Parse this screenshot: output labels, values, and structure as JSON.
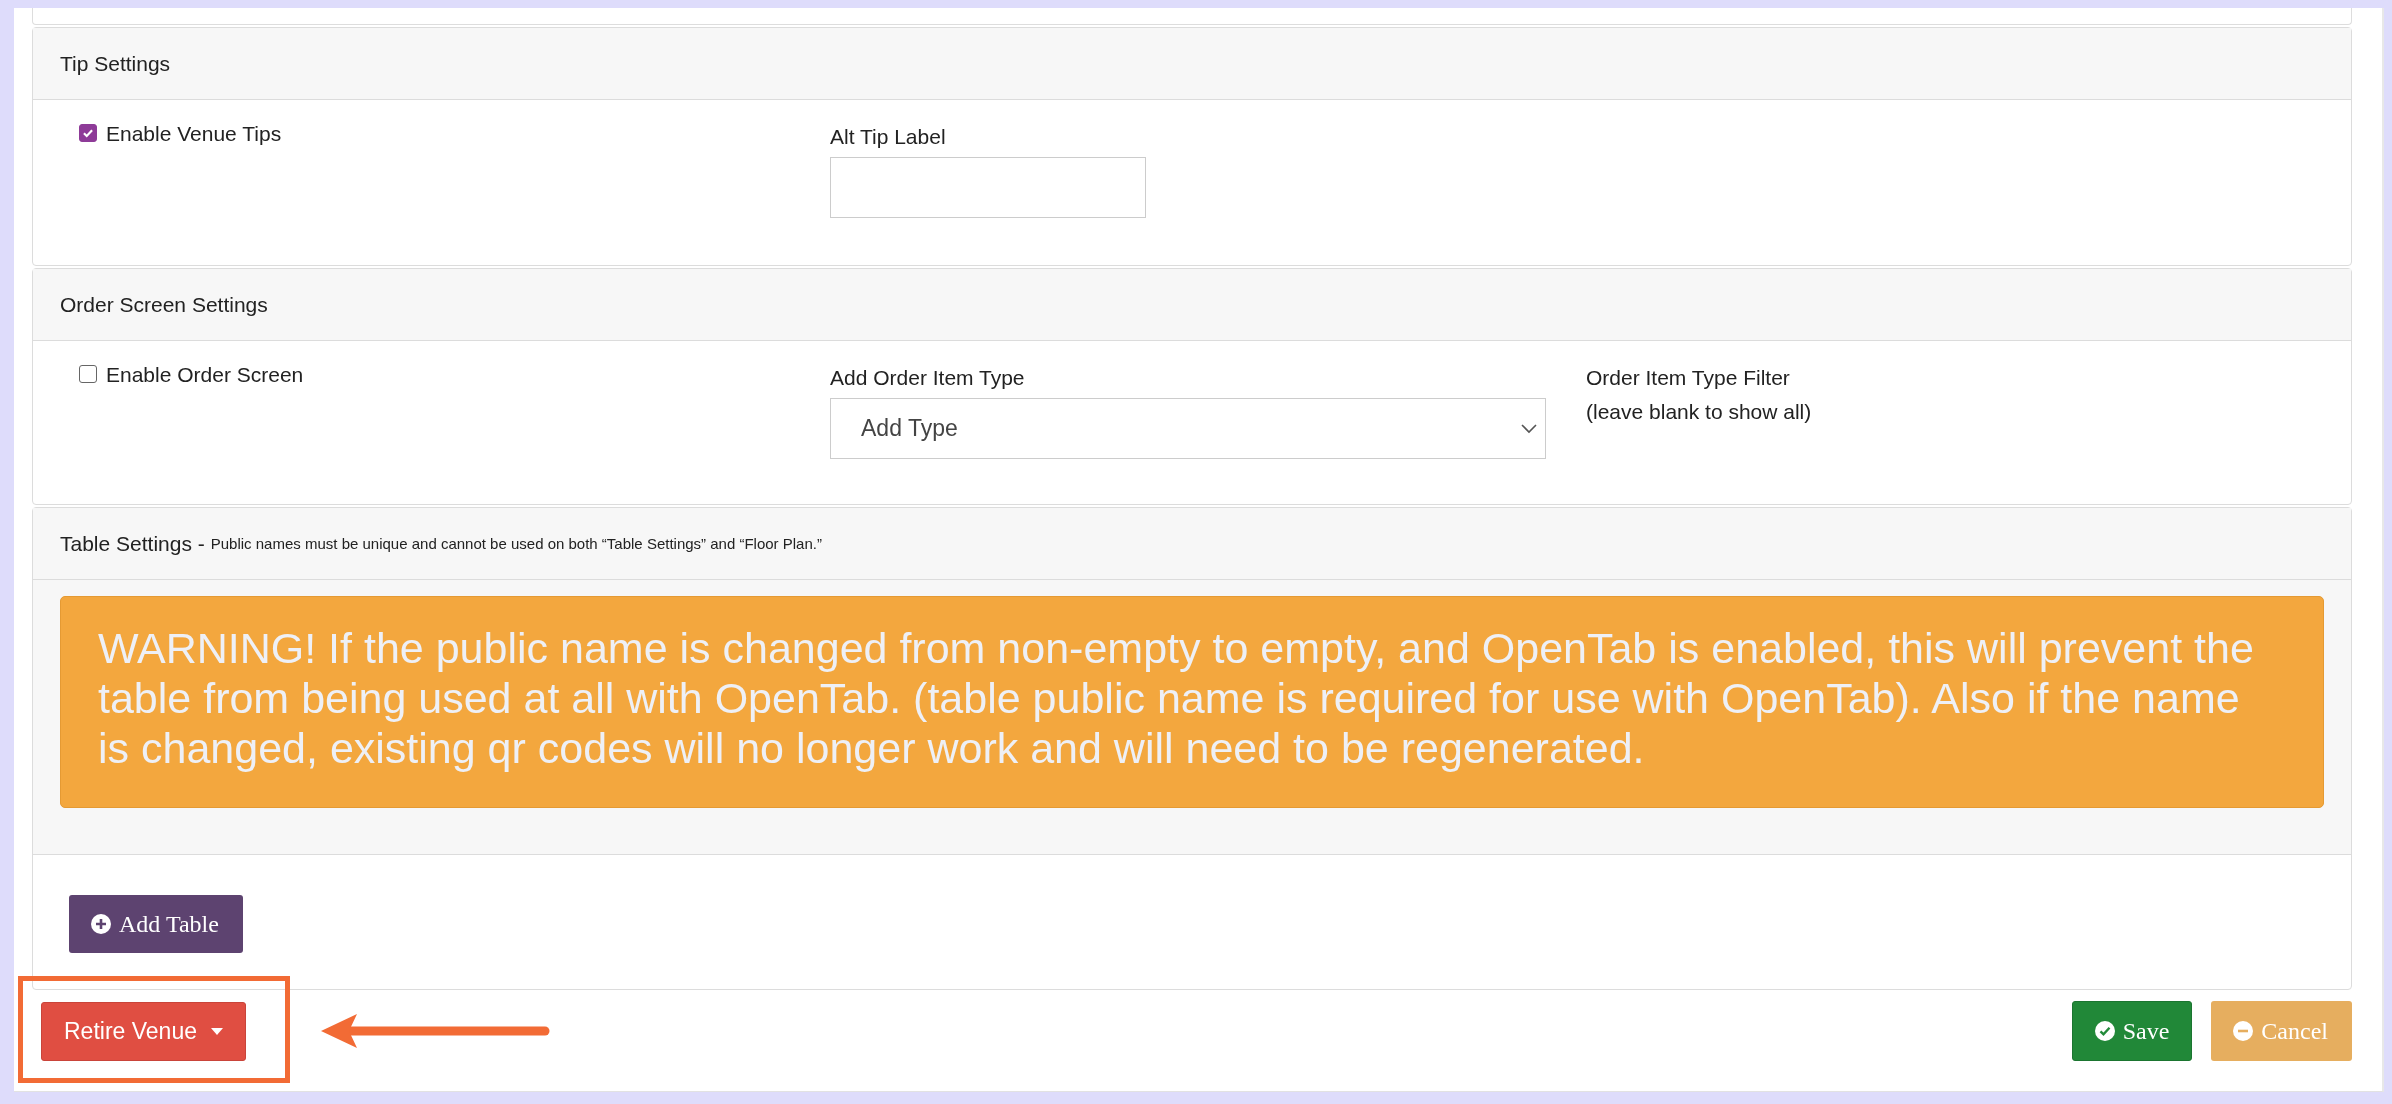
{
  "tip_settings": {
    "title": "Tip Settings",
    "enable_tips": {
      "label": "Enable Venue Tips",
      "checked": true
    },
    "alt_tip_label": {
      "label": "Alt Tip Label"
    }
  },
  "order_screen_settings": {
    "title": "Order Screen Settings",
    "enable_order_screen": {
      "label": "Enable Order Screen",
      "checked": false
    },
    "add_order_item_type": {
      "label": "Add Order Item Type",
      "value": "Add Type"
    },
    "order_item_type_filter": {
      "label": "Order Item Type Filter",
      "hint": "(leave blank to show all)"
    }
  },
  "table_settings": {
    "title": "Table Settings -",
    "note": "Public names must be unique and cannot be used on both “Table Settings” and “Floor Plan.”",
    "warning": "WARNING! If the public name is changed from non-empty to empty, and OpenTab is enabled, this will prevent the table from being used at all with OpenTab. (table public name is required for use with OpenTab). Also if the name is changed, existing qr codes will no longer work and will need to be regenerated.",
    "add_button": "Add Table"
  },
  "footer": {
    "retire_button": "Retire Venue",
    "save_button": "Save",
    "cancel_button": "Cancel"
  }
}
